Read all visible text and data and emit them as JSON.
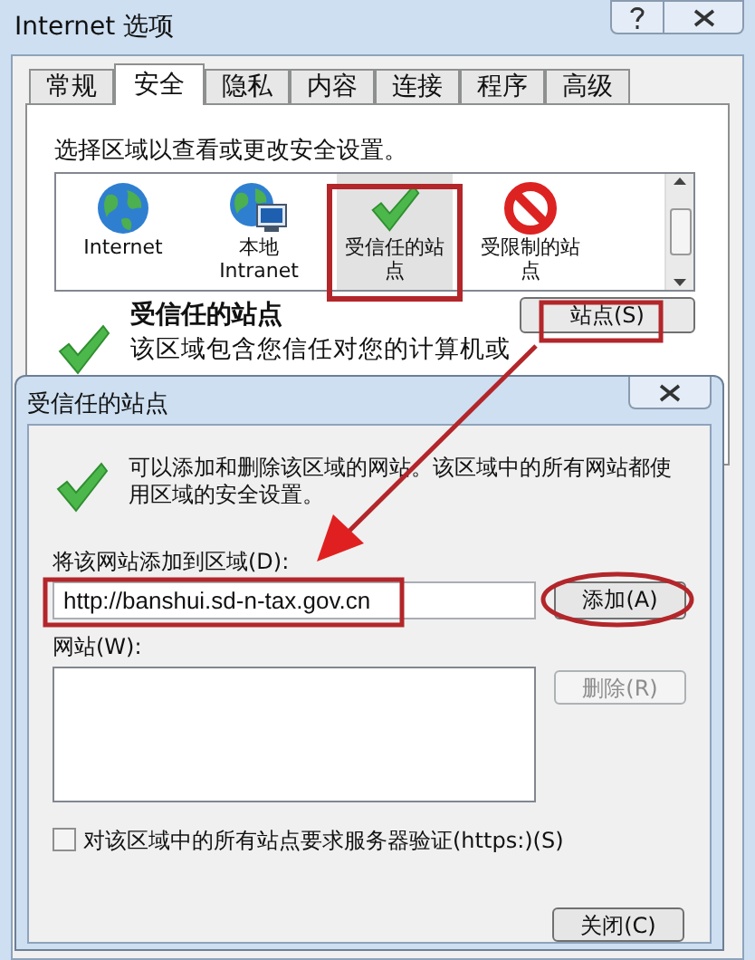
{
  "window": {
    "title": "Internet 选项"
  },
  "tabs": [
    {
      "label": "常规",
      "selected": false
    },
    {
      "label": "安全",
      "selected": true
    },
    {
      "label": "隐私",
      "selected": false
    },
    {
      "label": "内容",
      "selected": false
    },
    {
      "label": "连接",
      "selected": false
    },
    {
      "label": "程序",
      "selected": false
    },
    {
      "label": "高级",
      "selected": false
    }
  ],
  "zone_prompt": "选择区域以查看或更改安全设置。",
  "zones": [
    {
      "kind": "internet",
      "label": "Internet",
      "selected": false
    },
    {
      "kind": "intranet",
      "label": "本地 Intranet",
      "selected": false
    },
    {
      "kind": "trusted",
      "label": "受信任的站点",
      "selected": true
    },
    {
      "kind": "restricted",
      "label": "受限制的站点",
      "selected": false
    }
  ],
  "zone_info": {
    "title": "受信任的站点",
    "description": "该区域包含您信任对您的计算机或",
    "sites_button": "站点(S)"
  },
  "dialog": {
    "title": "受信任的站点",
    "message": "可以添加和删除该区域的网站。该区域中的所有网站都使用区域的安全设置。",
    "add_label": "将该网站添加到区域(D):",
    "url": "http://banshui.sd-n-tax.gov.cn",
    "add_button": "添加(A)",
    "sites_label": "网站(W):",
    "remove_button": {
      "label": "删除(R)",
      "disabled": true
    },
    "require_https": {
      "label": "对该区域中的所有站点要求服务器验证(https:)(S)",
      "checked": false
    },
    "close_button": "关闭(C)"
  }
}
